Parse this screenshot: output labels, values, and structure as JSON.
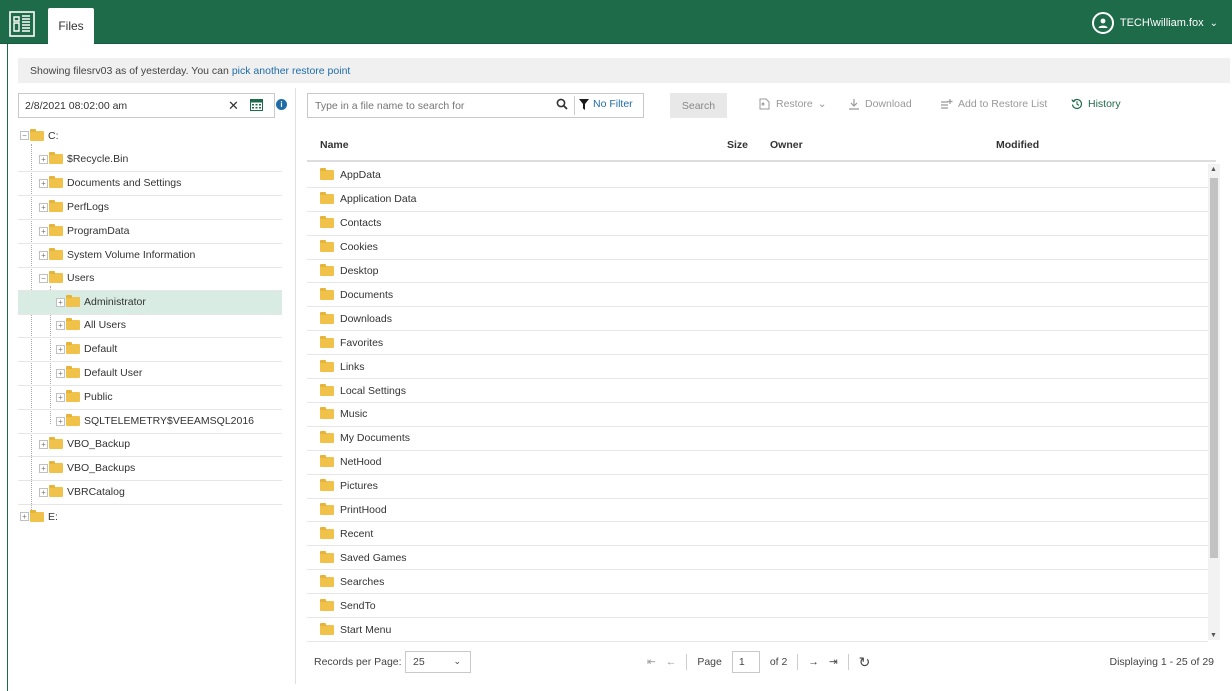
{
  "header": {
    "app_tab": "Files",
    "user": "TECH\\william.fox"
  },
  "notice": {
    "text": "Showing filesrv03 as of yesterday. You can",
    "link": "pick another restore point"
  },
  "restore_point": {
    "value": "2/8/2021 08:02:00 am"
  },
  "search": {
    "placeholder": "Type in a file name to search for",
    "filter_label": "No Filter",
    "search_button": "Search"
  },
  "toolbar": {
    "restore": "Restore",
    "download": "Download",
    "add_to_restore_list": "Add to Restore List",
    "history": "History"
  },
  "tree": {
    "nodes": [
      {
        "label": "C:"
      },
      {
        "label": "$Recycle.Bin"
      },
      {
        "label": "Documents and Settings"
      },
      {
        "label": "PerfLogs"
      },
      {
        "label": "ProgramData"
      },
      {
        "label": "System Volume Information"
      },
      {
        "label": "Users"
      },
      {
        "label": "Administrator"
      },
      {
        "label": "All Users"
      },
      {
        "label": "Default"
      },
      {
        "label": "Default User"
      },
      {
        "label": "Public"
      },
      {
        "label": "SQLTELEMETRY$VEEAMSQL2016"
      },
      {
        "label": "VBO_Backup"
      },
      {
        "label": "VBO_Backups"
      },
      {
        "label": "VBRCatalog"
      },
      {
        "label": "E:"
      }
    ],
    "selected": "Administrator"
  },
  "table": {
    "columns": [
      "Name",
      "Size",
      "Owner",
      "Modified"
    ],
    "rows": [
      "AppData",
      "Application Data",
      "Contacts",
      "Cookies",
      "Desktop",
      "Documents",
      "Downloads",
      "Favorites",
      "Links",
      "Local Settings",
      "Music",
      "My Documents",
      "NetHood",
      "Pictures",
      "PrintHood",
      "Recent",
      "Saved Games",
      "Searches",
      "SendTo",
      "Start Menu"
    ]
  },
  "footer": {
    "records_per_page_label": "Records per Page:",
    "records_per_page": "25",
    "page_label": "Page",
    "page": "1",
    "of_pages": "of 2",
    "displaying": "Displaying 1 - 25 of 29"
  },
  "colors": {
    "brand": "#1e6b4a",
    "link": "#1f6ca8",
    "selected_row": "#d9ece3",
    "folder": "#f0c24a"
  }
}
